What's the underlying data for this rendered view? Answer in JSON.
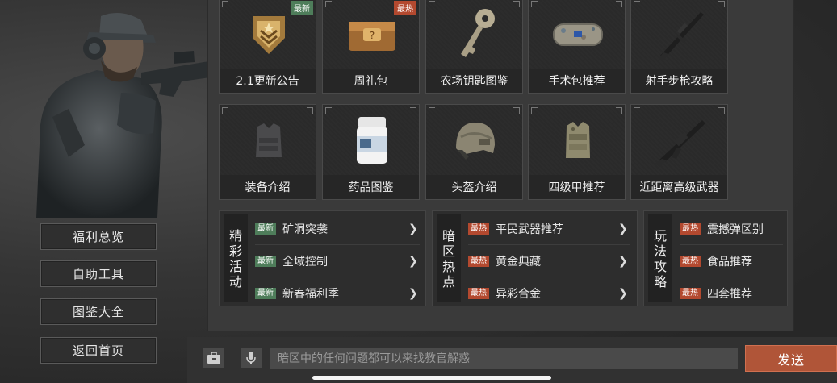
{
  "sidebar": {
    "items": [
      {
        "label": "福利总览"
      },
      {
        "label": "自助工具"
      },
      {
        "label": "图鉴大全"
      },
      {
        "label": "返回首页"
      }
    ]
  },
  "cards": [
    {
      "label": "2.1更新公告",
      "tag": "最新",
      "tag_type": "new",
      "icon": "rank-badge-icon"
    },
    {
      "label": "周礼包",
      "tag": "最热",
      "tag_type": "hot",
      "icon": "gift-box-icon"
    },
    {
      "label": "农场钥匙图鉴",
      "tag": "",
      "tag_type": "",
      "icon": "key-icon"
    },
    {
      "label": "手术包推荐",
      "tag": "",
      "tag_type": "",
      "icon": "surgery-kit-icon"
    },
    {
      "label": "射手步枪攻略",
      "tag": "",
      "tag_type": "",
      "icon": "rifle-icon"
    },
    {
      "label": "装备介绍",
      "tag": "",
      "tag_type": "",
      "icon": "vest-icon"
    },
    {
      "label": "药品图鉴",
      "tag": "",
      "tag_type": "",
      "icon": "medicine-bottle-icon"
    },
    {
      "label": "头盔介绍",
      "tag": "",
      "tag_type": "",
      "icon": "helmet-icon"
    },
    {
      "label": "四级甲推荐",
      "tag": "",
      "tag_type": "",
      "icon": "armor-icon"
    },
    {
      "label": "近距离高级武器",
      "tag": "",
      "tag_type": "",
      "icon": "assault-rifle-icon"
    }
  ],
  "groups": [
    {
      "title": "精彩活动",
      "rows": [
        {
          "tag": "最新",
          "tag_type": "new",
          "text": "矿洞突袭"
        },
        {
          "tag": "最新",
          "tag_type": "new",
          "text": "全域控制"
        },
        {
          "tag": "最新",
          "tag_type": "new",
          "text": "新春福利季"
        }
      ]
    },
    {
      "title": "暗区热点",
      "rows": [
        {
          "tag": "最热",
          "tag_type": "hot",
          "text": "平民武器推荐"
        },
        {
          "tag": "最热",
          "tag_type": "hot",
          "text": "黄金典藏"
        },
        {
          "tag": "最热",
          "tag_type": "hot",
          "text": "异彩合金"
        }
      ]
    },
    {
      "title": "玩法攻略",
      "rows": [
        {
          "tag": "最热",
          "tag_type": "hot",
          "text": "震撼弹区别"
        },
        {
          "tag": "最热",
          "tag_type": "hot",
          "text": "食品推荐"
        },
        {
          "tag": "最热",
          "tag_type": "hot",
          "text": "四套推荐"
        }
      ]
    }
  ],
  "chat": {
    "placeholder": "暗区中的任何问题都可以来找教官解惑",
    "send_label": "发送"
  },
  "colors": {
    "new_tag": "#4e7d5a",
    "hot_tag": "#b3492f",
    "send_button": "#b05538"
  }
}
